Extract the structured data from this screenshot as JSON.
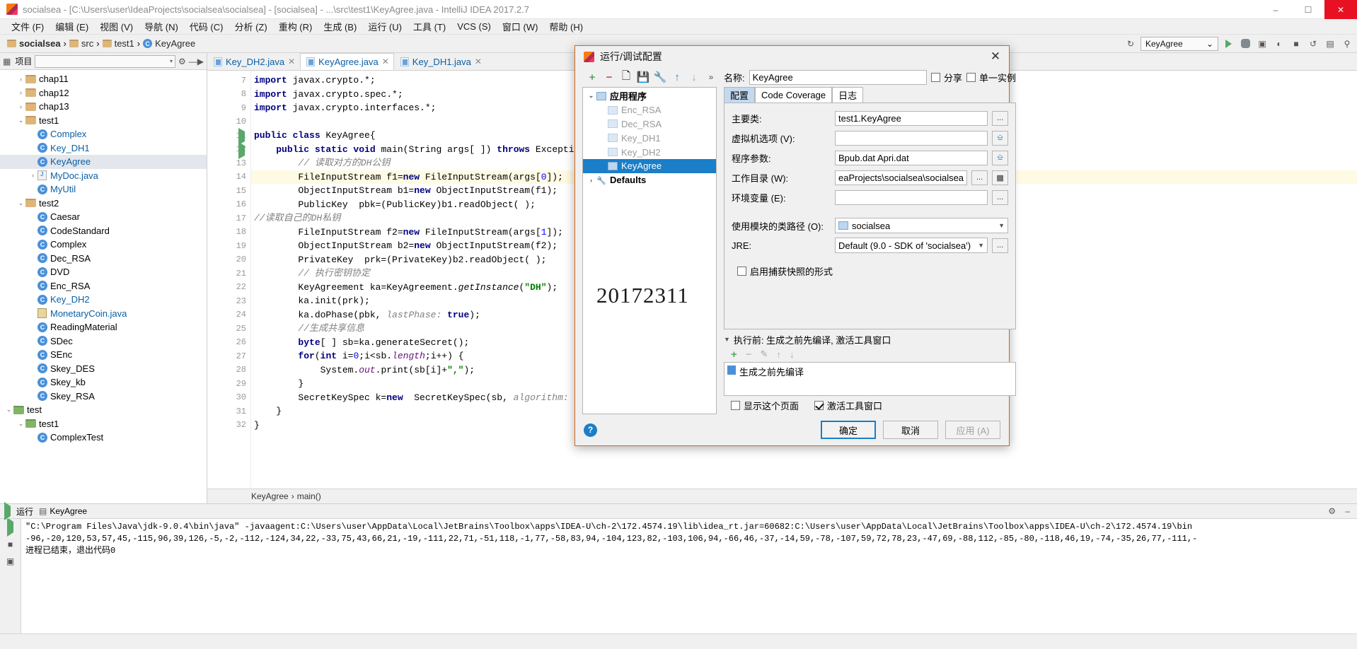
{
  "window": {
    "title": "socialsea - [C:\\Users\\user\\IdeaProjects\\socialsea\\socialsea] - [socialsea] - ...\\src\\test1\\KeyAgree.java - IntelliJ IDEA 2017.2.7",
    "minimize": "–",
    "maximize": "☐",
    "close": "✕"
  },
  "menubar": {
    "items": [
      "文件 (F)",
      "编辑 (E)",
      "视图 (V)",
      "导航 (N)",
      "代码 (C)",
      "分析 (Z)",
      "重构 (R)",
      "生成 (B)",
      "运行 (U)",
      "工具 (T)",
      "VCS (S)",
      "窗口 (W)",
      "帮助 (H)"
    ]
  },
  "navbar": {
    "crumbs": [
      {
        "label": "socialsea",
        "icon": "folder-icon",
        "bold": true
      },
      {
        "label": "src",
        "icon": "folder-icon",
        "bold": false
      },
      {
        "label": "test1",
        "icon": "folder-icon",
        "bold": false
      },
      {
        "label": "KeyAgree",
        "icon": "class-icon",
        "bold": false
      }
    ],
    "separator": "›",
    "run_config": "KeyAgree",
    "run_config_caret": "⌄",
    "icons": [
      "run-icon",
      "debug-icon",
      "coverage-icon",
      "profile-icon",
      "stop-icon",
      "sync-icon",
      "layout-icon",
      "search-icon"
    ]
  },
  "project_panel": {
    "title": "项目",
    "gear_icon": "gear-icon",
    "collapse_icon": "collapse-icon",
    "tree": [
      {
        "indent": 1,
        "arrow": "›",
        "icon": "folder",
        "label": "chap11",
        "color": "black"
      },
      {
        "indent": 1,
        "arrow": "›",
        "icon": "folder",
        "label": "chap12",
        "color": "black"
      },
      {
        "indent": 1,
        "arrow": "›",
        "icon": "folder",
        "label": "chap13",
        "color": "black"
      },
      {
        "indent": 1,
        "arrow": "⌄",
        "icon": "folder",
        "label": "test1",
        "color": "black"
      },
      {
        "indent": 2,
        "arrow": "",
        "icon": "class",
        "label": "Complex",
        "color": "blue"
      },
      {
        "indent": 2,
        "arrow": "",
        "icon": "class",
        "label": "Key_DH1",
        "color": "blue"
      },
      {
        "indent": 2,
        "arrow": "",
        "icon": "class",
        "label": "KeyAgree",
        "color": "blue",
        "selected": true
      },
      {
        "indent": 2,
        "arrow": "›",
        "icon": "java",
        "label": "MyDoc.java",
        "color": "blue"
      },
      {
        "indent": 2,
        "arrow": "",
        "icon": "class",
        "label": "MyUtil",
        "color": "blue"
      },
      {
        "indent": 1,
        "arrow": "⌄",
        "icon": "folder",
        "label": "test2",
        "color": "black"
      },
      {
        "indent": 2,
        "arrow": "",
        "icon": "class",
        "label": "Caesar",
        "color": "black"
      },
      {
        "indent": 2,
        "arrow": "",
        "icon": "class",
        "label": "CodeStandard",
        "color": "black"
      },
      {
        "indent": 2,
        "arrow": "",
        "icon": "class",
        "label": "Complex",
        "color": "black"
      },
      {
        "indent": 2,
        "arrow": "",
        "icon": "class",
        "label": "Dec_RSA",
        "color": "black"
      },
      {
        "indent": 2,
        "arrow": "",
        "icon": "class",
        "label": "DVD",
        "color": "black"
      },
      {
        "indent": 2,
        "arrow": "",
        "icon": "class",
        "label": "Enc_RSA",
        "color": "black"
      },
      {
        "indent": 2,
        "arrow": "",
        "icon": "class",
        "label": "Key_DH2",
        "color": "blue"
      },
      {
        "indent": 2,
        "arrow": "",
        "icon": "coin",
        "label": "MonetaryCoin.java",
        "color": "blue"
      },
      {
        "indent": 2,
        "arrow": "",
        "icon": "class",
        "label": "ReadingMaterial",
        "color": "black"
      },
      {
        "indent": 2,
        "arrow": "",
        "icon": "class",
        "label": "SDec",
        "color": "black"
      },
      {
        "indent": 2,
        "arrow": "",
        "icon": "class",
        "label": "SEnc",
        "color": "black"
      },
      {
        "indent": 2,
        "arrow": "",
        "icon": "class",
        "label": "Skey_DES",
        "color": "black"
      },
      {
        "indent": 2,
        "arrow": "",
        "icon": "class",
        "label": "Skey_kb",
        "color": "black"
      },
      {
        "indent": 2,
        "arrow": "",
        "icon": "class",
        "label": "Skey_RSA",
        "color": "black"
      },
      {
        "indent": 0,
        "arrow": "⌄",
        "icon": "folder-test",
        "label": "test",
        "color": "black"
      },
      {
        "indent": 1,
        "arrow": "⌄",
        "icon": "folder-test",
        "label": "test1",
        "color": "black"
      },
      {
        "indent": 2,
        "arrow": "",
        "icon": "class",
        "label": "ComplexTest",
        "color": "black"
      }
    ]
  },
  "editor": {
    "tabs": [
      {
        "label": "Key_DH2.java",
        "active": false,
        "close": "✕"
      },
      {
        "label": "KeyAgree.java",
        "active": true,
        "close": "✕"
      },
      {
        "label": "Key_DH1.java",
        "active": false,
        "close": "✕"
      }
    ],
    "first_line_number": 7,
    "lines": [
      {
        "n": 7,
        "html": "<span class=\"kw\">import</span> javax.crypto.*;"
      },
      {
        "n": 8,
        "html": "<span class=\"kw\">import</span> javax.crypto.spec.*;"
      },
      {
        "n": 9,
        "html": "<span class=\"kw\">import</span> javax.crypto.interfaces.*;"
      },
      {
        "n": 10,
        "html": ""
      },
      {
        "n": 11,
        "html": "<span class=\"kw\">public class</span> KeyAgree{",
        "run": true
      },
      {
        "n": 12,
        "html": "    <span class=\"kw\">public static void</span> main(String args[ ]) <span class=\"kw\">throws</span> Exception{",
        "run": true
      },
      {
        "n": 13,
        "html": "        <span class=\"cmt\">// 读取对方的DH公钥</span>"
      },
      {
        "n": 14,
        "html": "        FileInputStream f1=<span class=\"kw\">new</span> FileInputStream(args[<span class=\"num\">0</span>]);",
        "hl": true
      },
      {
        "n": 15,
        "html": "        ObjectInputStream b1=<span class=\"kw\">new</span> ObjectInputStream(f1);"
      },
      {
        "n": 16,
        "html": "        PublicKey  pbk=(PublicKey)b1.readObject( );"
      },
      {
        "n": 17,
        "html": "<span class=\"cmt\">//读取自己的DH私钥</span>"
      },
      {
        "n": 18,
        "html": "        FileInputStream f2=<span class=\"kw\">new</span> FileInputStream(args[<span class=\"num\">1</span>]);"
      },
      {
        "n": 19,
        "html": "        ObjectInputStream b2=<span class=\"kw\">new</span> ObjectInputStream(f2);"
      },
      {
        "n": 20,
        "html": "        PrivateKey  prk=(PrivateKey)b2.readObject( );"
      },
      {
        "n": 21,
        "html": "        <span class=\"cmt\">// 执行密钥协定</span>"
      },
      {
        "n": 22,
        "html": "        KeyAgreement ka=KeyAgreement.<span class=\"statc\">getInstance</span>(<span class=\"str\">\"DH\"</span>);"
      },
      {
        "n": 23,
        "html": "        ka.init(prk);"
      },
      {
        "n": 24,
        "html": "        ka.doPhase(pbk, <span class=\"par\">lastPhase:</span> <span class=\"kw\">true</span>);"
      },
      {
        "n": 25,
        "html": "        <span class=\"cmt\">//生成共享信息</span>"
      },
      {
        "n": 26,
        "html": "        <span class=\"kw\">byte</span>[ ] sb=ka.generateSecret();"
      },
      {
        "n": 27,
        "html": "        <span class=\"kw\">for</span>(<span class=\"kw\">int</span> i=<span class=\"num\">0</span>;i&lt;sb.<span class=\"fld\">length</span>;i++) {"
      },
      {
        "n": 28,
        "html": "            System.<span class=\"fld\">out</span>.print(sb[i]+<span class=\"str\">\",\"</span>);"
      },
      {
        "n": 29,
        "html": "        }"
      },
      {
        "n": 30,
        "html": "        SecretKeySpec k=<span class=\"kw\">new</span>  SecretKeySpec(sb, <span class=\"par\">algorithm:</span> <span class=\"str\">\"DESede\"</span>);"
      },
      {
        "n": 31,
        "html": "    }"
      },
      {
        "n": 32,
        "html": "}"
      }
    ],
    "breadcrumb": [
      "KeyAgree",
      "main()"
    ],
    "breadcrumb_sep": "›"
  },
  "run_panel": {
    "title": "运行",
    "tab_label": "KeyAgree",
    "gear_icon": "gear-icon",
    "minimize_icon": "minimize-icon",
    "toolbar_icons": [
      "rerun-icon",
      "stop-icon",
      "pin-icon"
    ],
    "console_lines": [
      "\"C:\\Program Files\\Java\\jdk-9.0.4\\bin\\java\" -javaagent:C:\\Users\\user\\AppData\\Local\\JetBrains\\Toolbox\\apps\\IDEA-U\\ch-2\\172.4574.19\\lib\\idea_rt.jar=60682:C:\\Users\\user\\AppData\\Local\\JetBrains\\Toolbox\\apps\\IDEA-U\\ch-2\\172.4574.19\\bin",
      "-96,-20,120,53,57,45,-115,96,39,126,-5,-2,-112,-124,34,22,-33,75,43,66,21,-19,-111,22,71,-51,118,-1,77,-58,83,94,-104,123,82,-103,106,94,-66,46,-37,-14,59,-78,-107,59,72,78,23,-47,69,-88,112,-85,-80,-118,46,19,-74,-35,26,77,-111,-",
      "进程已结束，退出代码0"
    ]
  },
  "dialog": {
    "title": "运行/调试配置",
    "icon": "intellij-icon",
    "close": "✕",
    "toolbar": {
      "add": "+",
      "remove": "−",
      "copy": "copy-icon",
      "save": "save-icon",
      "edit_templates": "wrench-icon",
      "move_up": "↑",
      "move_down": "↓",
      "more": "»"
    },
    "tree": [
      {
        "indent": 0,
        "arrow": "⌄",
        "label": "应用程序",
        "bold": true,
        "muted": false,
        "selected": false
      },
      {
        "indent": 1,
        "arrow": "",
        "label": "Enc_RSA",
        "bold": false,
        "muted": true,
        "selected": false
      },
      {
        "indent": 1,
        "arrow": "",
        "label": "Dec_RSA",
        "bold": false,
        "muted": true,
        "selected": false
      },
      {
        "indent": 1,
        "arrow": "",
        "label": "Key_DH1",
        "bold": false,
        "muted": true,
        "selected": false
      },
      {
        "indent": 1,
        "arrow": "",
        "label": "Key_DH2",
        "bold": false,
        "muted": true,
        "selected": false
      },
      {
        "indent": 1,
        "arrow": "",
        "label": "KeyAgree",
        "bold": false,
        "muted": false,
        "selected": true
      },
      {
        "indent": 0,
        "arrow": "›",
        "label": "Defaults",
        "bold": true,
        "muted": false,
        "selected": false
      }
    ],
    "name_label": "名称:",
    "name_value": "KeyAgree",
    "share_label": "分享",
    "share_checked": false,
    "single_instance_label": "单一实例",
    "single_instance_checked": false,
    "tabs": [
      {
        "label": "配置",
        "active": true
      },
      {
        "label": "Code Coverage",
        "active": false
      },
      {
        "label": "日志",
        "active": false
      }
    ],
    "fields": [
      {
        "label": "主要类:",
        "value": "test1.KeyAgree",
        "button": "..."
      },
      {
        "label": "虚拟机选项 (V):",
        "value": "",
        "button": "expand-icon"
      },
      {
        "label": "程序参数:",
        "value": "Bpub.dat Apri.dat",
        "button": "expand-icon"
      },
      {
        "label": "工作目录 (W):",
        "value": "eaProjects\\socialsea\\socialsea",
        "button": "...",
        "button2": "macro-icon"
      },
      {
        "label": "环境变量 (E):",
        "value": "",
        "button": "..."
      }
    ],
    "module_label": "使用模块的类路径 (O):",
    "module_value": "socialsea",
    "jre_label": "JRE:",
    "jre_value": "Default (9.0 - SDK of 'socialsea')",
    "jre_button": "...",
    "snapshot_label": "启用捕获快照的形式",
    "snapshot_checked": false,
    "before_run_title": "执行前: 生成之前先编译, 激活工具窗口",
    "before_run_caret": "▼",
    "before_run_toolbar": {
      "add": "+",
      "remove": "−",
      "edit": "✎",
      "up": "↑",
      "down": "↓"
    },
    "before_run_item": "生成之前先编译",
    "show_page_label": "显示这个页面",
    "show_page_checked": false,
    "activate_tool_label": "激活工具窗口",
    "activate_tool_checked": true,
    "help": "?",
    "buttons": [
      {
        "label": "确定",
        "style": "default"
      },
      {
        "label": "取消",
        "style": "normal"
      },
      {
        "label": "应用 (A)",
        "style": "disabled"
      }
    ]
  },
  "watermark": "20172311"
}
